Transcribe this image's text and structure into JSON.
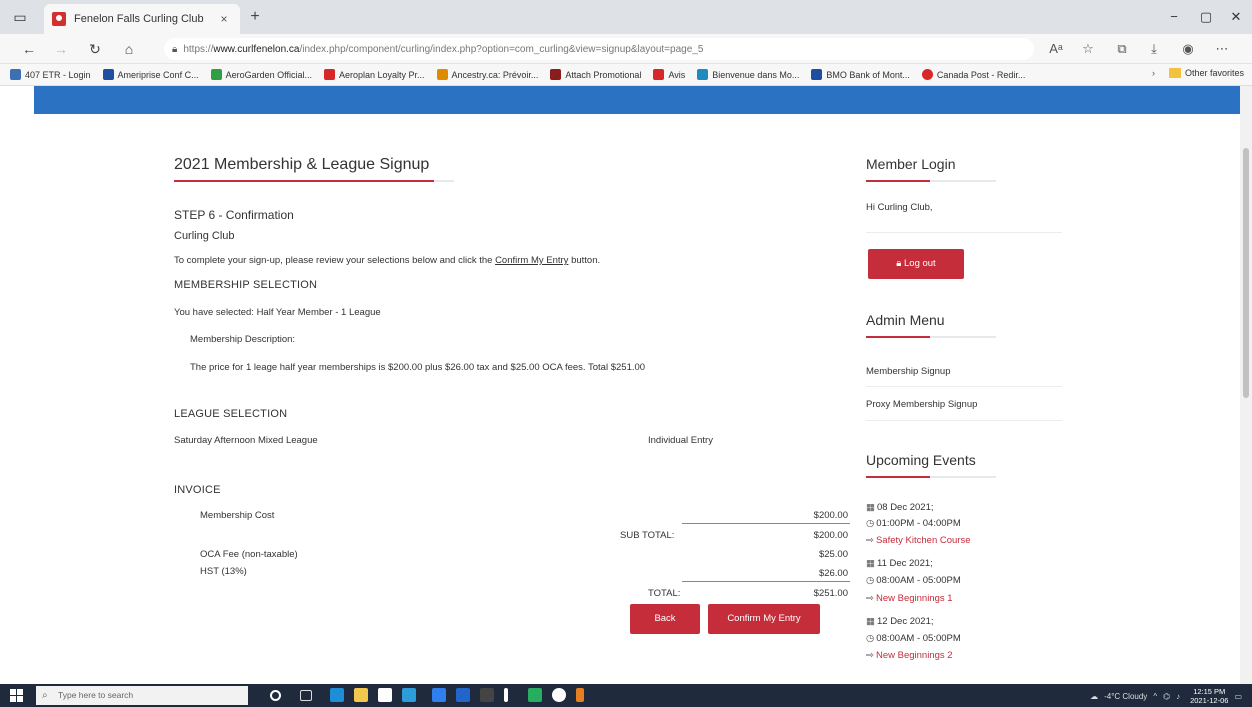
{
  "browser": {
    "tab_title": "Fenelon Falls Curling Club",
    "tab_close": "×",
    "new_tab": "+",
    "minimize": "−",
    "restore": "▢",
    "close": "✕",
    "url_prefix": "https://",
    "url_domain": "www.curlfenelon.ca",
    "url_rest": "/index.php/component/curling/index.php?option=com_curling&view=signup&layout=page_5",
    "favorites": [
      {
        "label": "407 ETR - Login",
        "color": "#3d6fb4"
      },
      {
        "label": "Ameriprise Conf C...",
        "color": "#1e4fa3"
      },
      {
        "label": "AeroGarden Official...",
        "color": "#2f9e44"
      },
      {
        "label": "Aeroplan Loyalty Pr...",
        "color": "#d62828"
      },
      {
        "label": "Ancestry.ca: Prévoir...",
        "color": "#e08a00"
      },
      {
        "label": "Attach Promotional",
        "color": "#8a1c1c"
      },
      {
        "label": "Avis",
        "color": "#d62828"
      },
      {
        "label": "Bienvenue dans Mo...",
        "color": "#1f8ac0"
      },
      {
        "label": "BMO Bank of Mont...",
        "color": "#1d4ea1"
      },
      {
        "label": "Canada Post - Redir...",
        "color": "#d62828"
      }
    ],
    "other_favorites": "Other favorites"
  },
  "main": {
    "title": "2021 Membership & League Signup",
    "step": "STEP 6 - Confirmation",
    "club": "Curling Club",
    "intro_before": "To complete your sign-up, please review your selections below and click the ",
    "intro_link": "Confirm My Entry",
    "intro_after": " button.",
    "membership_heading": "MEMBERSHIP SELECTION",
    "selected": "You have selected: Half Year Member - 1 League",
    "desc_label": "Membership Description:",
    "desc_text": "The price for 1 leage half year memberships is $200.00 plus $26.00 tax and $25.00 OCA fees. Total $251.00",
    "league_heading": "LEAGUE SELECTION",
    "league_name": "Saturday Afternoon Mixed League",
    "league_entry": "Individual Entry",
    "invoice_heading": "INVOICE",
    "invoice": {
      "membership_label": "Membership Cost",
      "membership_value": "$200.00",
      "subtotal_label": "SUB TOTAL:",
      "subtotal_value": "$200.00",
      "oca_label": "OCA Fee (non-taxable)",
      "oca_value": "$25.00",
      "hst_label": "HST (13%)",
      "hst_value": "$26.00",
      "total_label": "TOTAL:",
      "total_value": "$251.00"
    },
    "back_button": "Back",
    "confirm_button": "Confirm My Entry"
  },
  "sidebar": {
    "login_heading": "Member Login",
    "greeting": "Hi Curling Club,",
    "logout_button": "Log out",
    "admin_heading": "Admin Menu",
    "admin_items": [
      "Membership Signup",
      "Proxy Membership Signup"
    ],
    "events_heading": "Upcoming Events",
    "events": [
      {
        "date": "08 Dec 2021;",
        "time": "01:00PM - 04:00PM",
        "title": "Safety Kitchen Course"
      },
      {
        "date": "11 Dec 2021;",
        "time": "08:00AM - 05:00PM",
        "title": "New Beginnings 1"
      },
      {
        "date": "12 Dec 2021;",
        "time": "08:00AM - 05:00PM",
        "title": "New Beginnings 2"
      }
    ]
  },
  "taskbar": {
    "search_placeholder": "Type here to search",
    "weather": "-4°C Cloudy",
    "time": "12:15 PM",
    "date": "2021-12-06"
  }
}
